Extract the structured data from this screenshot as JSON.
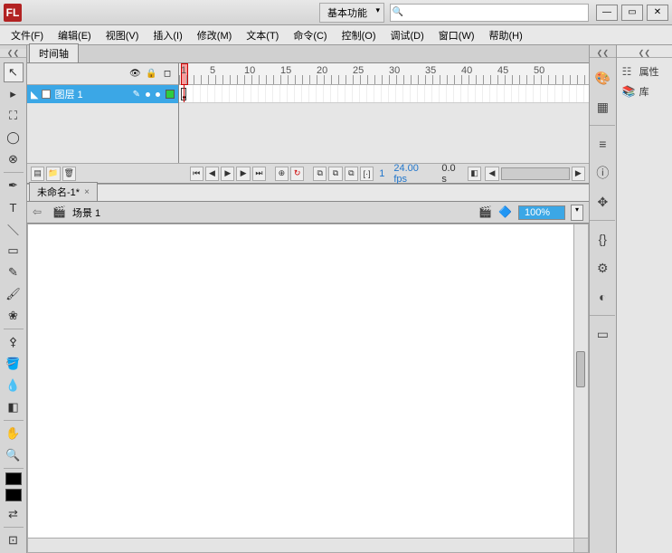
{
  "titlebar": {
    "logo_text": "FL",
    "workspace_label": "基本功能",
    "search_placeholder": ""
  },
  "menus": [
    "文件(F)",
    "编辑(E)",
    "视图(V)",
    "插入(I)",
    "修改(M)",
    "文本(T)",
    "命令(C)",
    "控制(O)",
    "调试(D)",
    "窗口(W)",
    "帮助(H)"
  ],
  "timeline": {
    "tab_label": "时间轴",
    "layer_name": "图层 1",
    "ruler_marks": [
      "1",
      "5",
      "10",
      "15",
      "20",
      "25",
      "30",
      "35",
      "40",
      "45",
      "50",
      "5"
    ],
    "footer": {
      "current_frame": "1",
      "fps": "24.00 fps",
      "time": "0.0 s"
    }
  },
  "document": {
    "tab_label": "未命名-1*"
  },
  "scenebar": {
    "scene_label": "场景 1",
    "zoom_value": "100%"
  },
  "right_panels": {
    "properties_label": "属性",
    "library_label": "库"
  },
  "colors": {
    "stroke_swatch": "#000000",
    "fill_swatch": "#000000"
  }
}
